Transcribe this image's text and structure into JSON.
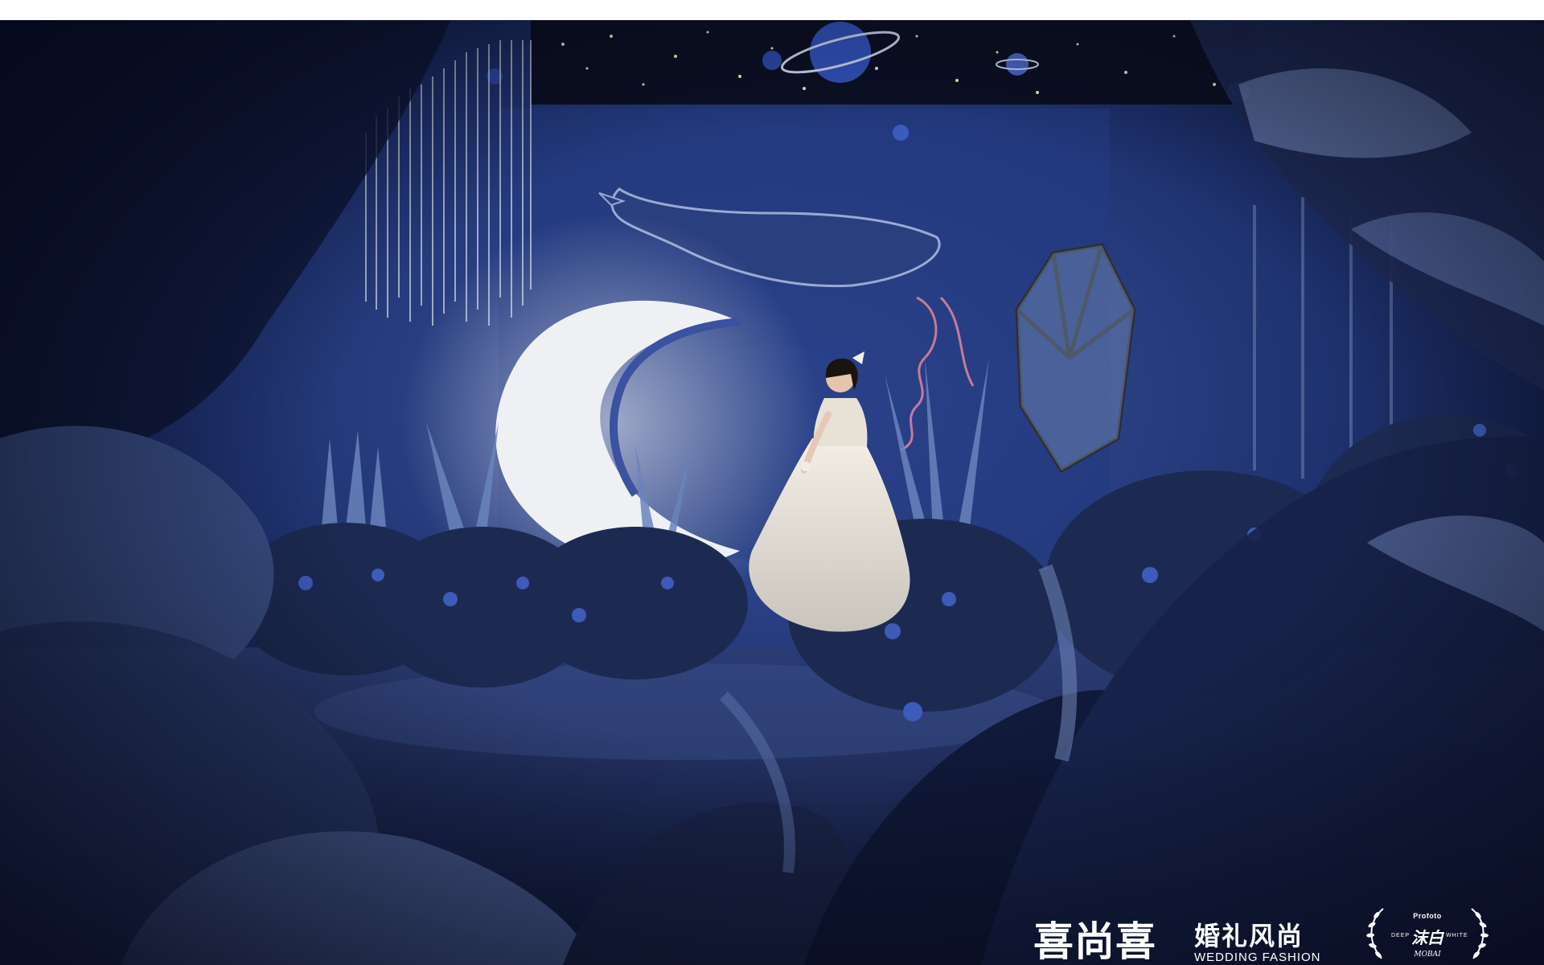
{
  "photo": {
    "scene": "wedding-stage",
    "colors": {
      "backdrop": "#1f3270",
      "moon": "#eef0f4",
      "dress": "#e8e4de",
      "foliage": "#1c2a52",
      "accent_pink": "#c77a9a"
    }
  },
  "watermark": {
    "brand_cn": "喜尚喜",
    "sub_cn": "婚礼风尚",
    "sub_en": "WEDDING FASHION"
  },
  "studio_badge": {
    "top": "Profoto",
    "mid": "沫白",
    "left": "DEEP",
    "right": "WHITE",
    "sig": "MOBAI"
  }
}
